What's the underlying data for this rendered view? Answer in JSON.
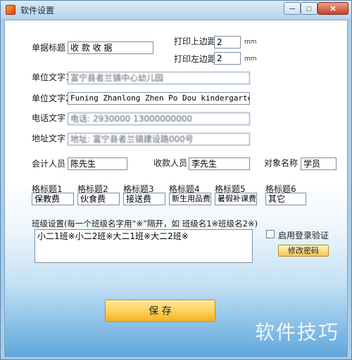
{
  "window": {
    "title": "软件设置",
    "min_label": "─",
    "max_label": "□",
    "close_label": "✕"
  },
  "form": {
    "receipt_title_label": "单据标题",
    "receipt_title_value": "收 款 收 据",
    "print_top_margin_label": "打印上边距",
    "print_top_margin_value": "2",
    "print_top_margin_unit": "mm",
    "print_left_margin_label": "打印左边距",
    "print_left_margin_value": "2",
    "print_left_margin_unit": "mm",
    "unit_text1_label": "单位文字1",
    "unit_text1_value": "富宁县者兰镇中心幼儿园",
    "unit_text2_label": "单位文字2",
    "unit_text2_value": "Funing Zhanlong Zhen Po Dou kindergarten",
    "phone_text_label": "电话文字",
    "phone_text_value": "电话: 2930000  13000000000",
    "address_text_label": "地址文字",
    "address_text_value": "地址: 富宁县者兰镇建设路000号",
    "accountant_label": "会计人员",
    "accountant_value": "陈先生",
    "cashier_label": "收款人员",
    "cashier_value": "李先生",
    "object_name_label": "对象名称",
    "object_name_value": "学员",
    "grid_headers": [
      {
        "label": "格标题1",
        "value": "保教费"
      },
      {
        "label": "格标题2",
        "value": "伙食费"
      },
      {
        "label": "格标题3",
        "value": "接送费"
      },
      {
        "label": "格标题4",
        "value": "新生用品费"
      },
      {
        "label": "格标题5",
        "value": "暑假补课费"
      },
      {
        "label": "格标题6",
        "value": "其它"
      }
    ],
    "class_setting_label": "班级设置(每一个班级名字用“※”隔开，如 班级名1※班级名2※)",
    "class_setting_value": "小二1班※小二2班※大二1班※大二2班※",
    "login_verify_label": "启用登录验证",
    "change_password_label": "修改密码",
    "save_label": "保  存"
  },
  "watermark": "软件技巧",
  "colors": {
    "accent_button": "#f3b321",
    "titlebar": "#b6d3ec",
    "close_button": "#c8412a"
  }
}
